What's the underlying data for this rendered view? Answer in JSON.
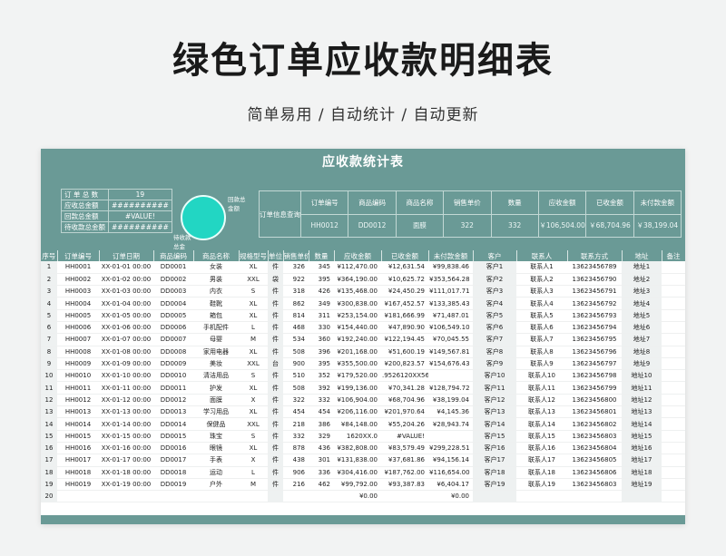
{
  "page": {
    "title": "绿色订单应收款明细表",
    "subtitle": "简单易用 / 自动统计 / 自动更新"
  },
  "sheet": {
    "title": "应收款统计表",
    "summary": [
      {
        "label": "订 单 总 数",
        "value": "19"
      },
      {
        "label": "应收总金额",
        "value": "##########"
      },
      {
        "label": "回款总金额",
        "value": "#VALUE!"
      },
      {
        "label": "待收款总金额",
        "value": "##########"
      }
    ],
    "circle_labels": {
      "top": "回款总",
      "top2": "金额",
      "bottom": "待收款",
      "bottom2": "总金"
    },
    "query": {
      "label": "订单信息查询",
      "headers": [
        "订单编号",
        "商品编码",
        "商品名称",
        "销售单价",
        "数量",
        "应收金额",
        "已收金额",
        "未付款金额"
      ],
      "values": [
        "HH0012",
        "DD0012",
        "面膜",
        "322",
        "332",
        "￥106,504.00",
        "￥68,704.96",
        "￥38,199.04"
      ]
    },
    "columns": [
      "序号",
      "订单编号",
      "订单日期",
      "商品编码",
      "商品名称",
      "规格型号",
      "单位",
      "销售单价",
      "数量",
      "应收金额",
      "已收金额",
      "未付款金额",
      "客户",
      "联系人",
      "联系方式",
      "地址",
      "备注"
    ],
    "rows": [
      [
        "1",
        "HH0001",
        "XX-01-01 00:00",
        "DD0001",
        "女装",
        "XL",
        "件",
        "326",
        "345",
        "¥112,470.00",
        "¥12,631.54",
        "¥99,838.46",
        "客户1",
        "联系人1",
        "13623456789",
        "地址1",
        ""
      ],
      [
        "2",
        "HH0002",
        "XX-01-02 00:00",
        "DD0002",
        "男装",
        "XXL",
        "袋",
        "922",
        "395",
        "¥364,190.00",
        "¥10,625.72",
        "¥353,564.28",
        "客户2",
        "联系人2",
        "13623456790",
        "地址2",
        ""
      ],
      [
        "3",
        "HH0003",
        "XX-01-03 00:00",
        "DD0003",
        "内衣",
        "S",
        "件",
        "318",
        "426",
        "¥135,468.00",
        "¥24,450.29",
        "¥111,017.71",
        "客户3",
        "联系人3",
        "13623456791",
        "地址3",
        ""
      ],
      [
        "4",
        "HH0004",
        "XX-01-04 00:00",
        "DD0004",
        "鞋靴",
        "XL",
        "件",
        "862",
        "349",
        "¥300,838.00",
        "¥167,452.57",
        "¥133,385.43",
        "客户4",
        "联系人4",
        "13623456792",
        "地址4",
        ""
      ],
      [
        "5",
        "HH0005",
        "XX-01-05 00:00",
        "DD0005",
        "箱包",
        "XL",
        "件",
        "814",
        "311",
        "¥253,154.00",
        "¥181,666.99",
        "¥71,487.01",
        "客户5",
        "联系人5",
        "13623456793",
        "地址5",
        ""
      ],
      [
        "6",
        "HH0006",
        "XX-01-06 00:00",
        "DD0006",
        "手机配件",
        "L",
        "件",
        "468",
        "330",
        "¥154,440.00",
        "¥47,890.90",
        "¥106,549.10",
        "客户6",
        "联系人6",
        "13623456794",
        "地址6",
        ""
      ],
      [
        "7",
        "HH0007",
        "XX-01-07 00:00",
        "DD0007",
        "母婴",
        "M",
        "件",
        "534",
        "360",
        "¥192,240.00",
        "¥122,194.45",
        "¥70,045.55",
        "客户7",
        "联系人7",
        "13623456795",
        "地址7",
        ""
      ],
      [
        "8",
        "HH0008",
        "XX-01-08 00:00",
        "DD0008",
        "家用电器",
        "XL",
        "件",
        "508",
        "396",
        "¥201,168.00",
        "¥51,600.19",
        "¥149,567.81",
        "客户8",
        "联系人8",
        "13623456796",
        "地址8",
        ""
      ],
      [
        "9",
        "HH0009",
        "XX-01-09 00:00",
        "DD0009",
        "美妆",
        "XXL",
        "台",
        "900",
        "395",
        "¥355,500.00",
        "¥200,823.57",
        "¥154,676.43",
        "客户9",
        "联系人9",
        "13623456797",
        "地址9",
        ""
      ],
      [
        "10",
        "HH0010",
        "XX-01-10 00:00",
        "DD0010",
        "清洁用品",
        "S",
        "件",
        "510",
        "352",
        "¥179,520.00",
        ".9526120XX56",
        "",
        "客户10",
        "联系人10",
        "13623456798",
        "地址10",
        ""
      ],
      [
        "11",
        "HH0011",
        "XX-01-11 00:00",
        "DD0011",
        "护发",
        "XL",
        "件",
        "508",
        "392",
        "¥199,136.00",
        "¥70,341.28",
        "¥128,794.72",
        "客户11",
        "联系人11",
        "13623456799",
        "地址11",
        ""
      ],
      [
        "12",
        "HH0012",
        "XX-01-12 00:00",
        "DD0012",
        "面膜",
        "X",
        "件",
        "322",
        "332",
        "¥106,904.00",
        "¥68,704.96",
        "¥38,199.04",
        "客户12",
        "联系人12",
        "13623456800",
        "地址12",
        ""
      ],
      [
        "13",
        "HH0013",
        "XX-01-13 00:00",
        "DD0013",
        "学习用品",
        "XL",
        "件",
        "454",
        "454",
        "¥206,116.00",
        "¥201,970.64",
        "¥4,145.36",
        "客户13",
        "联系人13",
        "13623456801",
        "地址13",
        ""
      ],
      [
        "14",
        "HH0014",
        "XX-01-14 00:00",
        "DD0014",
        "保健品",
        "XXL",
        "件",
        "218",
        "386",
        "¥84,148.00",
        "¥55,204.26",
        "¥28,943.74",
        "客户14",
        "联系人14",
        "13623456802",
        "地址14",
        ""
      ],
      [
        "15",
        "HH0015",
        "XX-01-15 00:00",
        "DD0015",
        "珠宝",
        "S",
        "件",
        "332",
        "329",
        "1620XX.0",
        "#VALUE!",
        "",
        "客户15",
        "联系人15",
        "13623456803",
        "地址15",
        ""
      ],
      [
        "16",
        "HH0016",
        "XX-01-16 00:00",
        "DD0016",
        "眼镜",
        "XL",
        "件",
        "878",
        "436",
        "¥382,808.00",
        "¥83,579.49",
        "¥299,228.51",
        "客户16",
        "联系人16",
        "13623456804",
        "地址16",
        ""
      ],
      [
        "17",
        "HH0017",
        "XX-01-17 00:00",
        "DD0017",
        "手表",
        "X",
        "件",
        "438",
        "301",
        "¥131,838.00",
        "¥37,681.86",
        "¥94,156.14",
        "客户17",
        "联系人17",
        "13623456805",
        "地址17",
        ""
      ],
      [
        "18",
        "HH0018",
        "XX-01-18 00:00",
        "DD0018",
        "运动",
        "L",
        "件",
        "906",
        "336",
        "¥304,416.00",
        "¥187,762.00",
        "¥116,654.00",
        "客户18",
        "联系人18",
        "13623456806",
        "地址18",
        ""
      ],
      [
        "19",
        "HH0019",
        "XX-01-19 00:00",
        "DD0019",
        "户外",
        "M",
        "件",
        "216",
        "462",
        "¥99,792.00",
        "¥93,387.83",
        "¥6,404.17",
        "客户19",
        "联系人19",
        "13623456803",
        "地址19",
        ""
      ],
      [
        "20",
        "",
        "",
        "",
        "",
        "",
        "",
        "",
        "",
        "¥0.00",
        "",
        "¥0.00",
        "",
        "",
        "",
        "",
        ""
      ]
    ]
  }
}
